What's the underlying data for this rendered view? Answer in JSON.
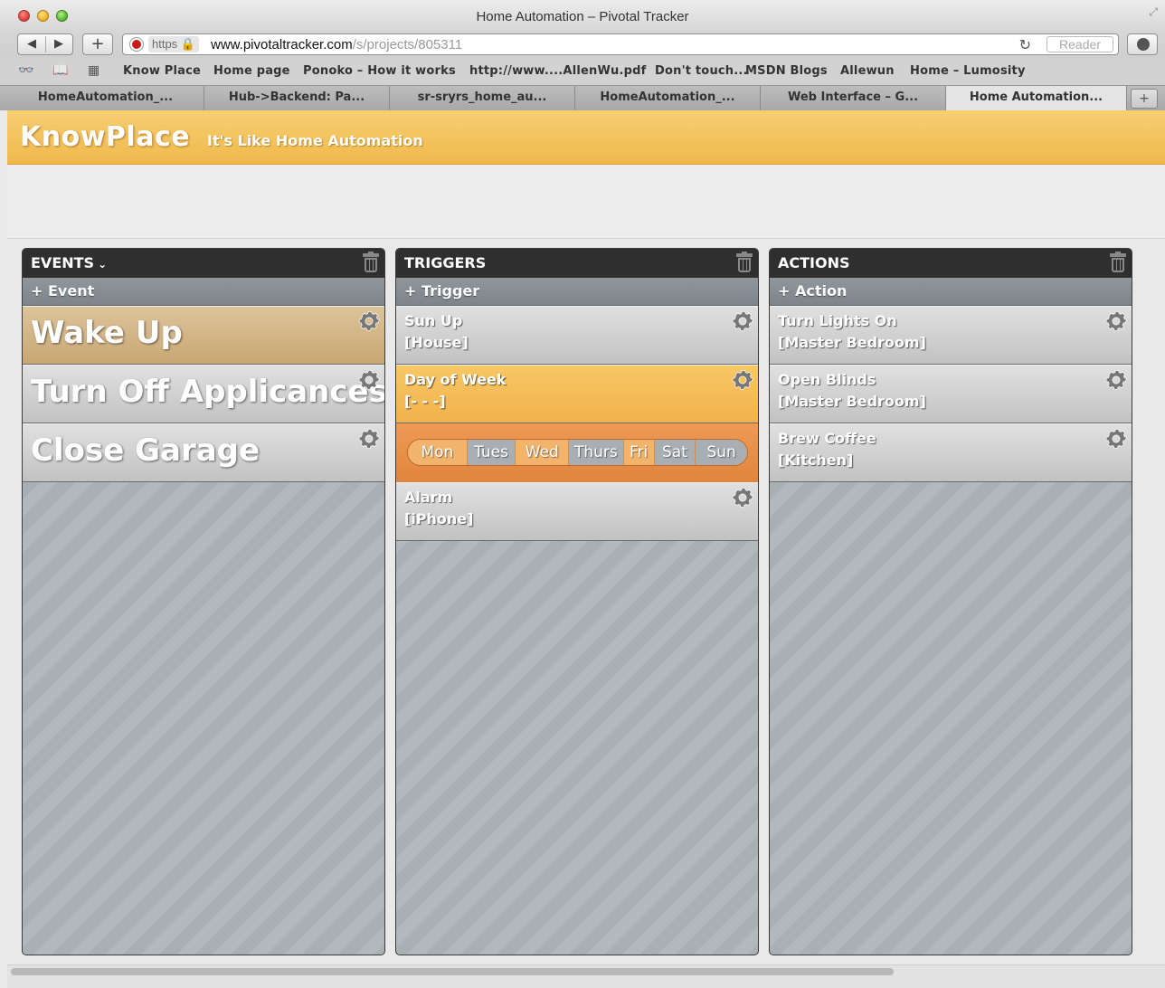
{
  "window": {
    "title": "Home Automation – Pivotal Tracker"
  },
  "toolbar": {
    "back": "◀",
    "forward": "▶",
    "new_tab": "+",
    "url_scheme": "https",
    "url_host": "www.pivotaltracker.com",
    "url_path": "/s/projects/805311",
    "reader": "Reader"
  },
  "bookmarks": [
    "Know Place",
    "Home page",
    "Ponoko – How it works",
    "http://www....AllenWu.pdf",
    "Don't touch...",
    "MSDN Blogs",
    "Allewun",
    "Home – Lumosity"
  ],
  "tabs": [
    {
      "label": "HomeAutomation_...",
      "active": false
    },
    {
      "label": "Hub->Backend: Pa...",
      "active": false
    },
    {
      "label": "sr-sryrs_home_au...",
      "active": false
    },
    {
      "label": "HomeAutomation_...",
      "active": false
    },
    {
      "label": "Web Interface – G...",
      "active": false
    },
    {
      "label": "Home Automation...",
      "active": true
    }
  ],
  "app": {
    "logo": "KnowPlace",
    "tagline": "It's Like Home Automation"
  },
  "events": {
    "title": "EVENTS",
    "add_label": "+ Event",
    "items": [
      "Wake Up",
      "Turn Off Applicances",
      "Close Garage"
    ]
  },
  "triggers": {
    "title": "TRIGGERS",
    "add_label": "+ Trigger",
    "items": [
      {
        "name": "Sun Up",
        "target": "[House]"
      },
      {
        "name": "Day of Week",
        "target": "[- - -]"
      },
      {
        "name": "Alarm",
        "target": "[iPhone]"
      }
    ],
    "days": [
      {
        "label": "Mon",
        "selected": true
      },
      {
        "label": "Tues",
        "selected": false
      },
      {
        "label": "Wed",
        "selected": true
      },
      {
        "label": "Thurs",
        "selected": false
      },
      {
        "label": "Fri",
        "selected": true
      },
      {
        "label": "Sat",
        "selected": false
      },
      {
        "label": "Sun",
        "selected": false
      }
    ]
  },
  "actions": {
    "title": "ACTIONS",
    "add_label": "+ Action",
    "items": [
      {
        "name": "Turn Lights On",
        "target": "[Master Bedroom]"
      },
      {
        "name": "Open Blinds",
        "target": "[Master Bedroom]"
      },
      {
        "name": "Brew Coffee",
        "target": "[Kitchen]"
      }
    ]
  },
  "colors": {
    "header_orange": "#f0b84c",
    "selected_event": "#c9a774",
    "selected_trigger": "#f0b24c",
    "day_panel": "#e0853d",
    "column_header": "#2f2f2f"
  }
}
